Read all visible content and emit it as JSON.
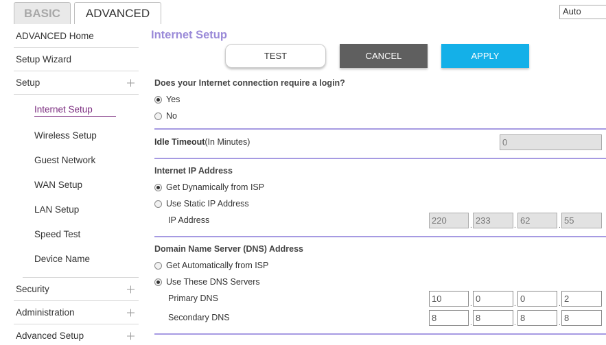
{
  "tabs": {
    "basic": "BASIC",
    "advanced": "ADVANCED"
  },
  "language_select": {
    "value": "Auto"
  },
  "sidebar": {
    "top_items": [
      {
        "label": "ADVANCED Home",
        "expandable": false
      },
      {
        "label": "Setup Wizard",
        "expandable": false
      },
      {
        "label": "Setup",
        "expandable": true
      }
    ],
    "setup_sub_items": [
      {
        "label": "Internet Setup",
        "active": true
      },
      {
        "label": "Wireless Setup"
      },
      {
        "label": "Guest Network"
      },
      {
        "label": "WAN Setup"
      },
      {
        "label": "LAN Setup"
      },
      {
        "label": "Speed Test"
      },
      {
        "label": "Device Name"
      }
    ],
    "bottom_items": [
      {
        "label": "Security"
      },
      {
        "label": "Administration"
      },
      {
        "label": "Advanced Setup"
      }
    ]
  },
  "main": {
    "title": "Internet Setup",
    "buttons": {
      "test": "TEST",
      "cancel": "CANCEL",
      "apply": "APPLY"
    },
    "login_question": "Does your Internet connection require a login?",
    "login_options": {
      "yes": "Yes",
      "no": "No",
      "selected": "yes"
    },
    "idle_timeout": {
      "label_bold": "Idle Timeout",
      "label_suffix": "(In Minutes)",
      "value": "0"
    },
    "ip_section": {
      "heading": "Internet IP Address",
      "option_dynamic": "Get Dynamically from ISP",
      "option_static": "Use Static IP Address",
      "selected": "dynamic",
      "ip_label": "IP Address",
      "ip": [
        "220",
        "233",
        "62",
        "55"
      ]
    },
    "dns_section": {
      "heading": "Domain Name Server (DNS) Address",
      "option_auto": "Get Automatically from ISP",
      "option_manual": "Use These DNS Servers",
      "selected": "manual",
      "primary_label": "Primary DNS",
      "primary": [
        "10",
        "0",
        "0",
        "2"
      ],
      "secondary_label": "Secondary DNS",
      "secondary": [
        "8",
        "8",
        "8",
        "8"
      ]
    }
  },
  "colors": {
    "title": "#9a8ad8",
    "rule": "#a69ae2",
    "active_nav": "#7b2c7f",
    "apply": "#14b0e8",
    "cancel": "#5f5f5f"
  },
  "icons": {
    "expand": "plus-icon"
  }
}
